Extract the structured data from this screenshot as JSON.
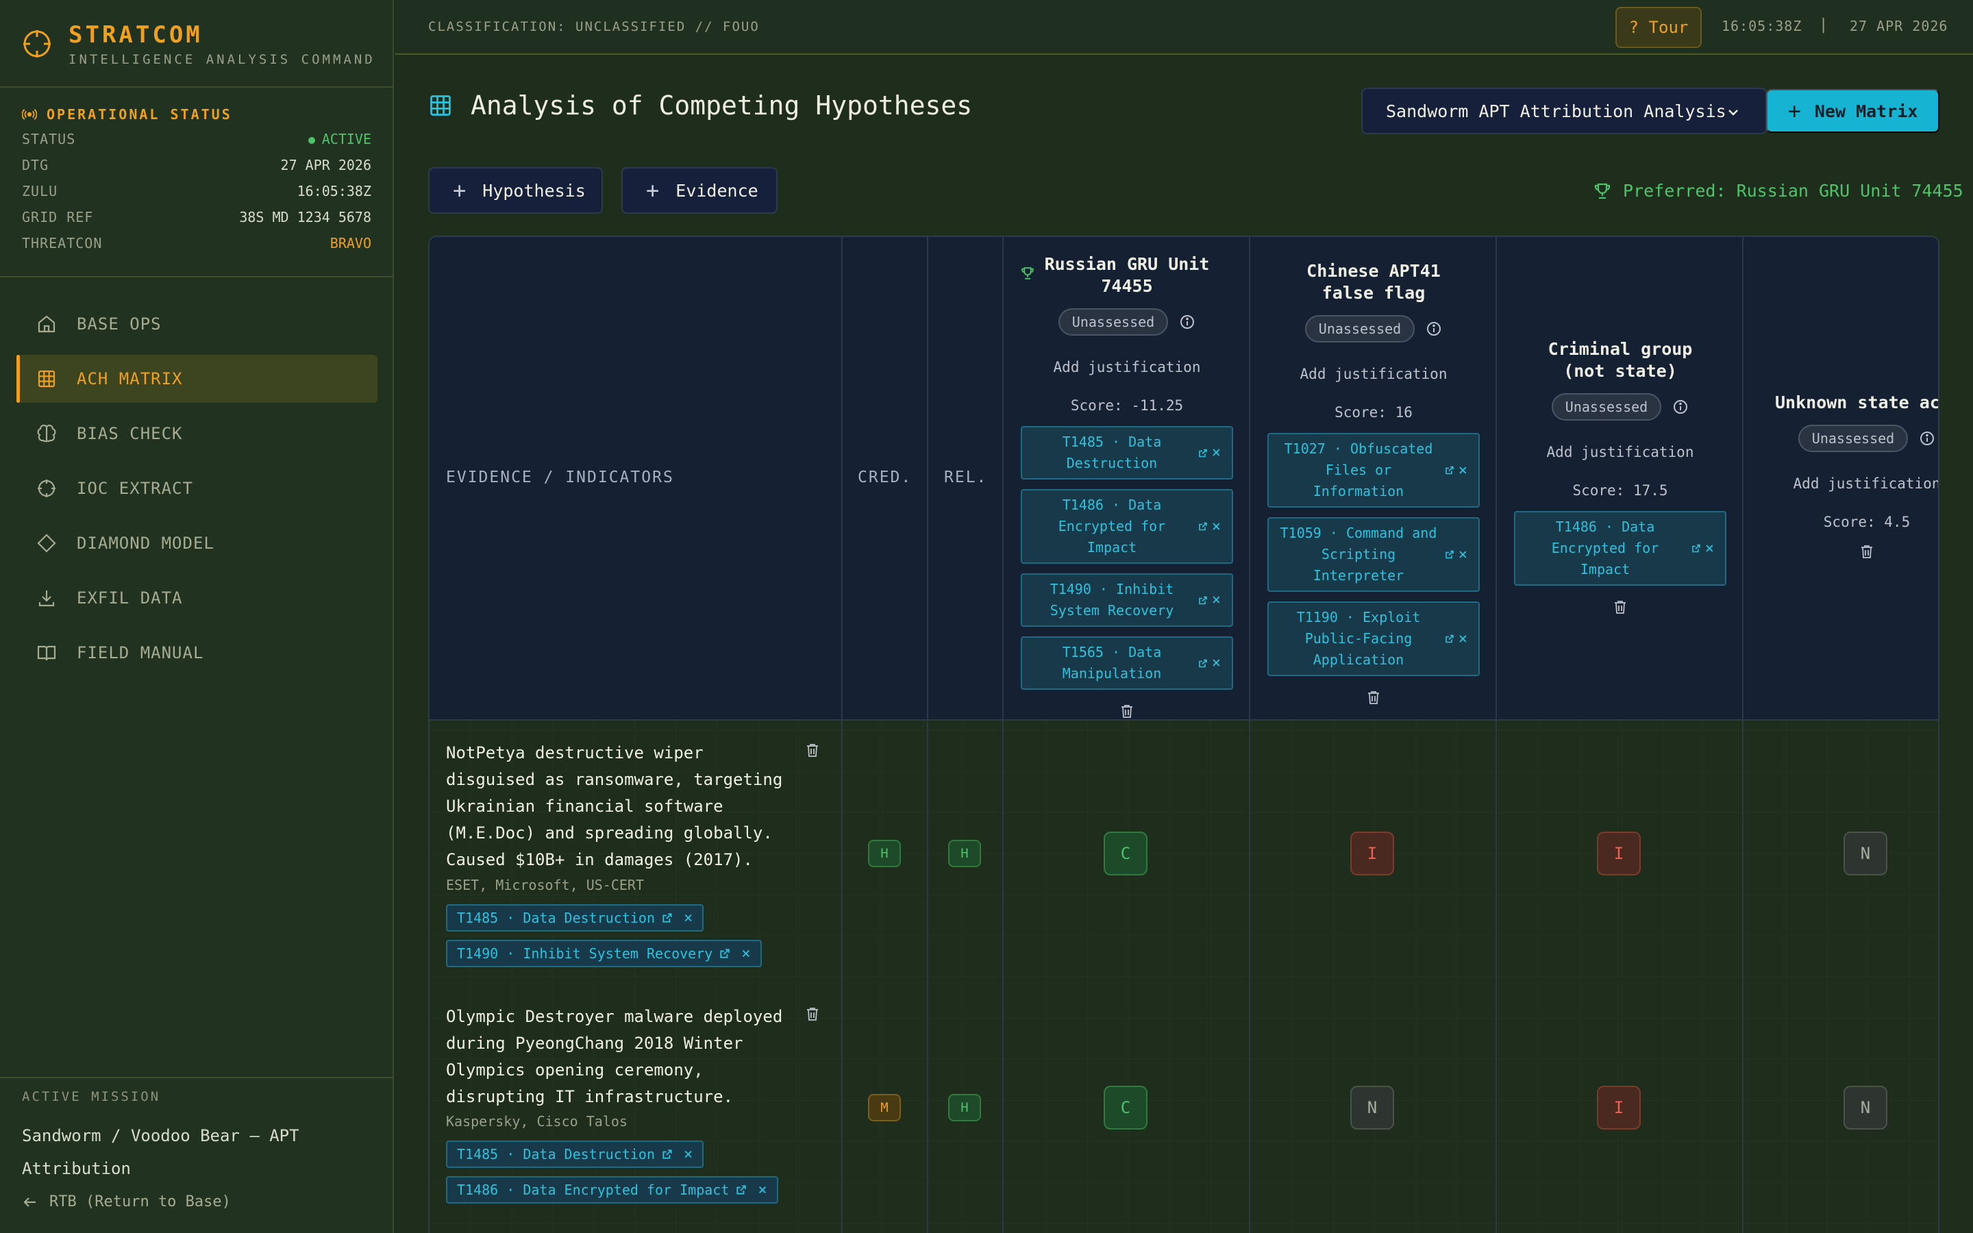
{
  "brand": {
    "title": "STRATCOM",
    "subtitle": "INTELLIGENCE ANALYSIS COMMAND"
  },
  "opstatus": {
    "heading": "OPERATIONAL STATUS",
    "rows": [
      {
        "key": "STATUS",
        "value": "ACTIVE"
      },
      {
        "key": "DTG",
        "value": "27 APR 2026"
      },
      {
        "key": "ZULU",
        "value": "16:05:38Z"
      },
      {
        "key": "GRID REF",
        "value": "38S MD 1234 5678"
      },
      {
        "key": "THREATCON",
        "value": "BRAVO"
      }
    ]
  },
  "nav": {
    "items": [
      {
        "label": "BASE OPS",
        "icon": "home-icon"
      },
      {
        "label": "ACH MATRIX",
        "icon": "grid-icon"
      },
      {
        "label": "BIAS CHECK",
        "icon": "brain-icon"
      },
      {
        "label": "IOC EXTRACT",
        "icon": "crosshair-icon"
      },
      {
        "label": "DIAMOND MODEL",
        "icon": "diamond-icon"
      },
      {
        "label": "EXFIL DATA",
        "icon": "download-icon"
      },
      {
        "label": "FIELD MANUAL",
        "icon": "book-icon"
      }
    ],
    "active": "ACH MATRIX"
  },
  "mission": {
    "label": "ACTIVE MISSION",
    "name": "Sandworm / Voodoo Bear — APT Attribution",
    "rtb": "RTB (Return to Base)"
  },
  "topbar": {
    "classification": "CLASSIFICATION: UNCLASSIFIED // FOUO",
    "tour": "? Tour",
    "clock": "16:05:38Z",
    "separator": "|",
    "date": "27 APR 2026"
  },
  "main": {
    "title": "Analysis of Competing Hypotheses",
    "matrix_select": "Sandworm APT Attribution Analysis",
    "new_matrix": "New Matrix",
    "add_hypothesis": "Hypothesis",
    "add_evidence": "Evidence",
    "preferred": "Preferred: Russian GRU Unit 74455"
  },
  "matrix": {
    "headers": {
      "evidence": "EVIDENCE / INDICATORS",
      "cred": "CRED.",
      "rel": "REL."
    },
    "hypotheses": [
      {
        "title": "Russian GRU Unit 74455",
        "badge": "Unassessed",
        "justification": "Add justification",
        "score": "Score: -11.25",
        "ttps": [
          "T1485 · Data Destruction",
          "T1486 · Data Encrypted for Impact",
          "T1490 · Inhibit System Recovery",
          "T1565 · Data Manipulation"
        ]
      },
      {
        "title": "Chinese APT41 false flag",
        "badge": "Unassessed",
        "justification": "Add justification",
        "score": "Score: 16",
        "ttps": [
          "T1027 · Obfuscated Files or Information",
          "T1059 · Command and Scripting Interpreter",
          "T1190 · Exploit Public-Facing Application"
        ]
      },
      {
        "title": "Criminal group (not state)",
        "badge": "Unassessed",
        "justification": "Add justification",
        "score": "Score: 17.5",
        "ttps": [
          "T1486 · Data Encrypted for Impact"
        ]
      },
      {
        "title": "Unknown state act",
        "badge": "Unassessed",
        "justification": "Add justification",
        "score": "Score: 4.5",
        "ttps": []
      }
    ],
    "evidence": [
      {
        "text": "NotPetya destructive wiper disguised as ransomware, targeting Ukrainian financial software (M.E.Doc) and spreading globally. Caused $10B+ in damages (2017).",
        "source": "ESET, Microsoft, US-CERT",
        "cred": "H",
        "rel": "H",
        "tags": [
          "T1485 · Data Destruction",
          "T1490 · Inhibit System Recovery"
        ],
        "ratings": [
          "C",
          "I",
          "I",
          "N"
        ]
      },
      {
        "text": "Olympic Destroyer malware deployed during PyeongChang 2018 Winter Olympics opening ceremony, disrupting IT infrastructure.",
        "source": "Kaspersky, Cisco Talos",
        "cred": "M",
        "rel": "H",
        "tags": [
          "T1485 · Data Destruction",
          "T1486 · Data Encrypted for Impact"
        ],
        "ratings": [
          "C",
          "N",
          "I",
          "N"
        ]
      }
    ],
    "close_glyph": "×"
  }
}
